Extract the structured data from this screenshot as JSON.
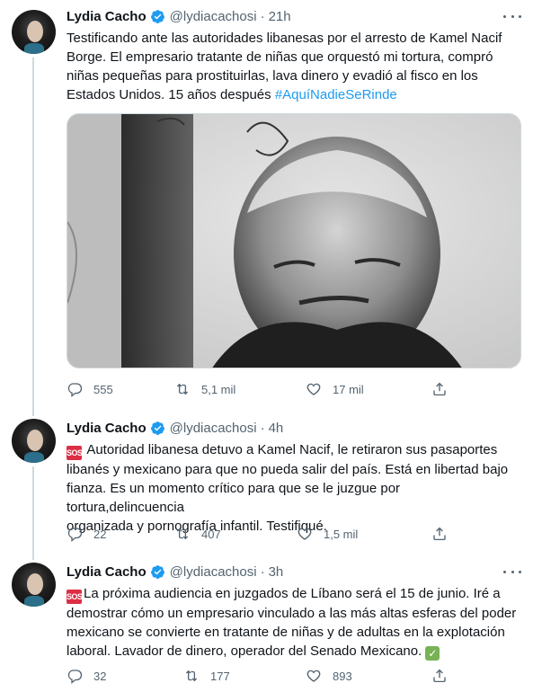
{
  "tweets": [
    {
      "name": "Lydia Cacho",
      "handle": "@lydiacachosi",
      "dot": "·",
      "time": "21h",
      "text_line_1": "Testificando ante las autoridades libanesas por el arresto de Kamel Nacif",
      "text_line_2": "Borge. El empresario tratante de niñas que orquestó mi tortura, compró",
      "text_line_3": "niñas pequeñas para prostituirlas, lava dinero y evadió al fisco en los",
      "text_line_4_plain": "Estados Unidos.  15 años después ",
      "hashtag": "#AquíNadieSeRinde",
      "replies": "555",
      "retweets": "5,1 mil",
      "likes": "17 mil"
    },
    {
      "name": "Lydia Cacho",
      "handle": "@lydiacachosi",
      "dot": "·",
      "time": "4h",
      "sos": "SOS",
      "text_line_1": " Autoridad libanesa detuvo a Kamel Nacif, le retiraron sus pasaportes",
      "text_line_2": "libanés y mexicano para que no pueda salir del país. Está en libertad bajo",
      "text_line_3": "fianza. Es un momento crítico para que se le juzgue por tortura,delincuencia",
      "text_line_4": "organizada y pornografía  infantil. Testifiqué.",
      "replies": "22",
      "retweets": "407",
      "likes": "1,5 mil"
    },
    {
      "name": "Lydia Cacho",
      "handle": "@lydiacachosi",
      "dot": "·",
      "time": "3h",
      "sos": "SOS",
      "text_line_1": "La próxima audiencia en juzgados de Líbano será el 15 de junio. Iré a",
      "text_line_2": "demostrar cómo un empresario vinculado a las más altas esferas del poder",
      "text_line_3": "mexicano se convierte en tratante de niñas y de adultas en la explotación",
      "text_line_4": "laboral. Lavador de dinero, operador del Senado Mexicano. ",
      "check": "✓",
      "replies": "32",
      "retweets": "177",
      "likes": "893"
    }
  ],
  "colors": {
    "link": "#1d9bf0",
    "muted": "#536471",
    "verified": "#1d9bf0",
    "sos": "#dd2e44",
    "check": "#77b255"
  },
  "icons": [
    "verified-badge-icon",
    "more-options-icon",
    "reply-icon",
    "retweet-icon",
    "like-icon",
    "share-icon",
    "sos-emoji",
    "check-mark-emoji"
  ]
}
